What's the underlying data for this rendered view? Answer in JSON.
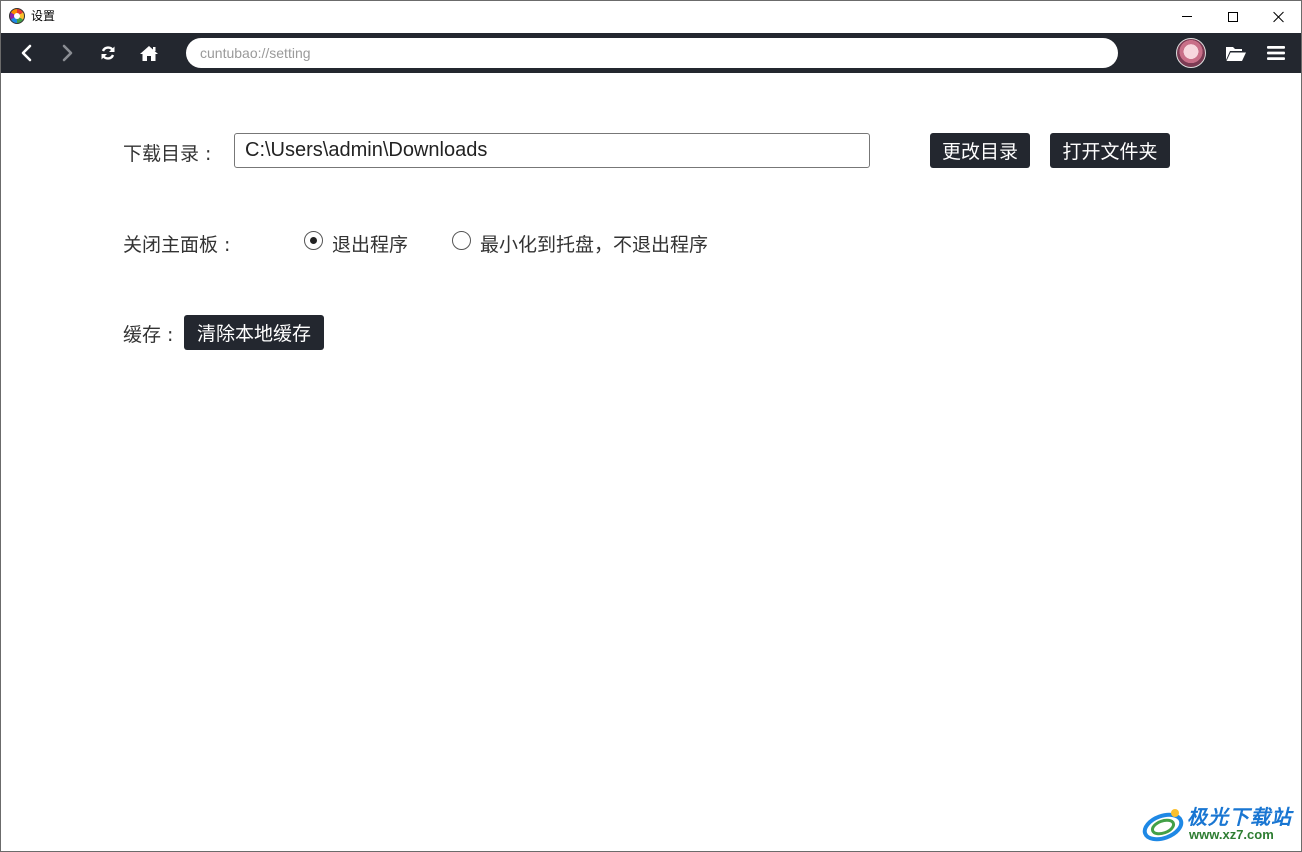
{
  "window": {
    "title": "设置",
    "controls": {
      "minimize_icon": "minimize-icon",
      "maximize_icon": "maximize-icon",
      "close_icon": "close-icon"
    }
  },
  "toolbar": {
    "address": "cuntubao://setting",
    "icons": [
      "back-icon",
      "forward-icon",
      "refresh-icon",
      "home-icon",
      "avatar",
      "folder-open-icon",
      "menu-icon"
    ],
    "background": "#23272f"
  },
  "settings": {
    "download_dir": {
      "label": "下载目录 :",
      "value": "C:\\Users\\admin\\Downloads",
      "change_button": "更改目录",
      "open_button": "打开文件夹"
    },
    "close_panel": {
      "label": "关闭主面板 :",
      "options": [
        {
          "label": "退出程序",
          "selected": true
        },
        {
          "label": "最小化到托盘，不退出程序",
          "selected": false
        }
      ]
    },
    "cache": {
      "label": "缓存 :",
      "clear_button": "清除本地缓存"
    }
  },
  "watermark": {
    "brand": "极光下载站",
    "url": "www.xz7.com"
  },
  "colors": {
    "dark_button": "#23272f",
    "watermark_blue": "#1976d2",
    "watermark_green": "#2e7d32"
  }
}
